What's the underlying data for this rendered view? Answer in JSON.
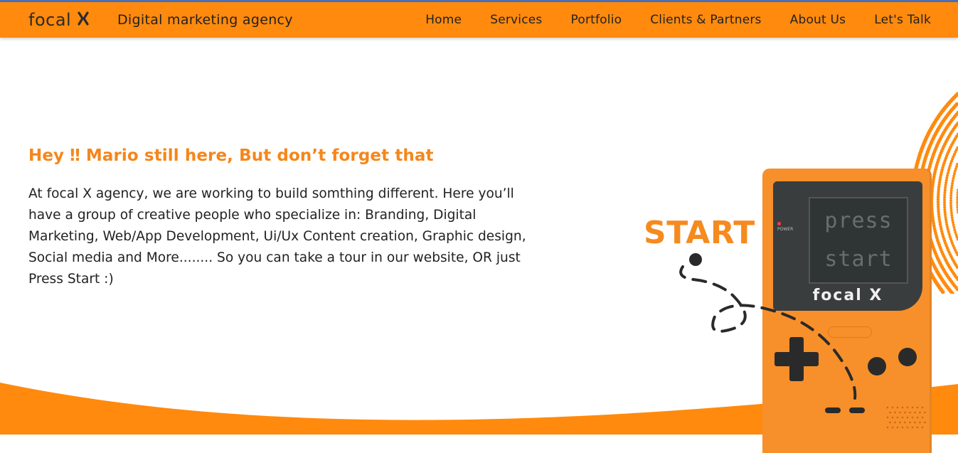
{
  "header": {
    "logo_text": "focal",
    "logo_mark": "X",
    "tagline": "Digital marketing agency",
    "nav": [
      {
        "label": "Home"
      },
      {
        "label": "Services"
      },
      {
        "label": "Portfolio"
      },
      {
        "label": "Clients & Partners"
      },
      {
        "label": "About Us"
      },
      {
        "label": "Let's Talk"
      }
    ]
  },
  "hero": {
    "headline": "Hey ‼ Mario still here, But don’t forget that",
    "body": "At focal X agency, we are working to build somthing different. Here you’ll have a group of creative people who specialize in: Branding, Digital Marketing, Web/App Development, Ui/Ux Content creation, Graphic design, Social media and More........ So you can take a tour in our website, OR just Press Start :)",
    "start_label": "START"
  },
  "gameboy": {
    "screen_line_1": "press",
    "screen_line_2": "start",
    "brand": "focal X",
    "power_label": "POWER"
  },
  "colors": {
    "brand_orange": "#ff8a0d",
    "headline_orange": "#f5861a",
    "text_dark": "#222222"
  },
  "icons": {
    "logo_mark": "x-cross-icon",
    "dpad": "dpad-icon",
    "buttons": "round-button-icon"
  }
}
